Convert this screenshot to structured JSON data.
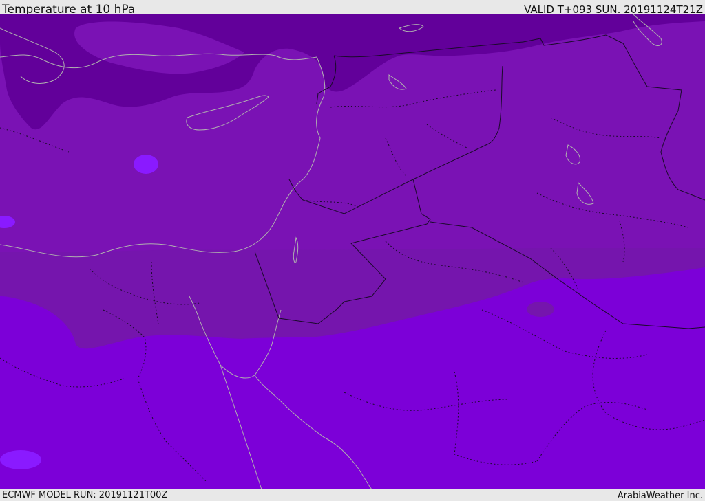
{
  "header": {
    "title": "Temperature at 10 hPa",
    "valid_time": "VALID T+093 SUN. 20191124T21Z"
  },
  "footer": {
    "model_run": "ECMWF MODEL RUN: 20191121T00Z",
    "credit": "ArabiaWeather Inc."
  },
  "map": {
    "region": "Eastern Mediterranean / Middle East",
    "colors": {
      "coldest_band": "#62009a",
      "cold_band": "#7a12b4",
      "mid_band": "#7515ad",
      "warm_band": "#7c00d8",
      "warm_spot": "#8a1aff",
      "coastline": "#b0b0b0",
      "borders": "#1a0a2a"
    }
  }
}
